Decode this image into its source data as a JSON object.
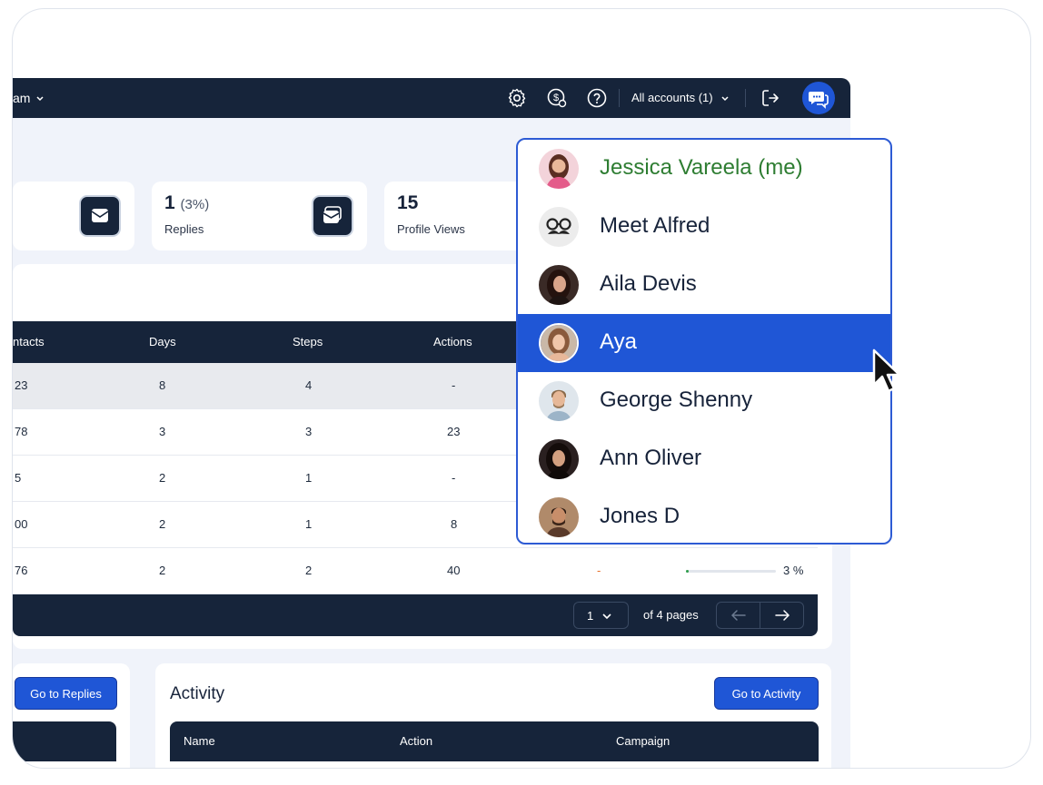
{
  "topbar": {
    "team_label": "am",
    "accounts_label": "All accounts (1)",
    "icons": [
      "gear-icon",
      "billing-icon",
      "help-icon",
      "logout-icon",
      "chat-icon"
    ]
  },
  "kpis": [
    {
      "value": "1",
      "sub": "(3%)",
      "label": "Replies"
    },
    {
      "value": "15",
      "label": "Profile Views"
    }
  ],
  "campaigns_table": {
    "columns": [
      "ntacts",
      "Days",
      "Steps",
      "Actions"
    ],
    "rows": [
      {
        "contacts": "23",
        "days": "8",
        "steps": "4",
        "actions": "-"
      },
      {
        "contacts": "78",
        "days": "3",
        "steps": "3",
        "actions": "23"
      },
      {
        "contacts": "5",
        "days": "2",
        "steps": "1",
        "actions": "-"
      },
      {
        "contacts": "00",
        "days": "2",
        "steps": "1",
        "actions": "8"
      },
      {
        "contacts": "76",
        "days": "2",
        "steps": "2",
        "actions": "40",
        "extra": "-",
        "progress_pct": 3,
        "progress_label": "3 %"
      }
    ],
    "pagination": {
      "page": "1",
      "of_pages": "of 4 pages"
    }
  },
  "replies_panel": {
    "button": "Go to Replies"
  },
  "activity_panel": {
    "title": "Activity",
    "button": "Go to Activity",
    "columns": [
      "Name",
      "Action",
      "Campaign"
    ]
  },
  "account_dropdown": {
    "items": [
      {
        "name": "Jessica Vareela (me)",
        "color": "#2e7d32",
        "active": false
      },
      {
        "name": "Meet Alfred",
        "active": false
      },
      {
        "name": "Aila Devis",
        "active": false
      },
      {
        "name": "Aya",
        "active": true
      },
      {
        "name": "George Shenny",
        "active": false
      },
      {
        "name": "Ann Oliver",
        "active": false
      },
      {
        "name": "Jones D",
        "active": false
      }
    ]
  },
  "colors": {
    "navy": "#16243a",
    "accent": "#1f56d6",
    "me_green": "#2e7d32"
  }
}
